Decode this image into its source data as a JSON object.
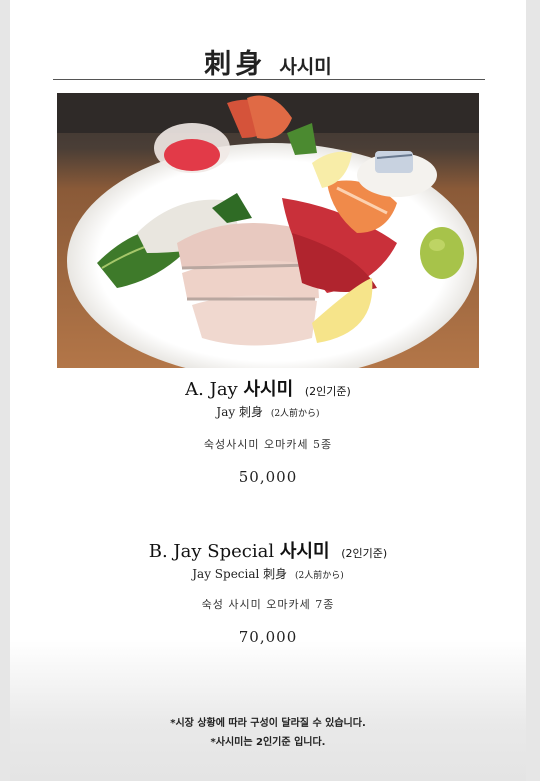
{
  "header": {
    "title_kanji": "刺身",
    "title_korean": "사시미"
  },
  "image": {
    "icon": "sashimi-platter-photo"
  },
  "menu": [
    {
      "name": "A. Jay",
      "name_korean": "사시미",
      "note": "(2인기준)",
      "sub_name": "Jay 刺身",
      "sub_note": "(2人前から)",
      "description": "숙성사시미 오마카세 5종",
      "price": "50,000"
    },
    {
      "name": "B. Jay Special",
      "name_korean": "사시미",
      "note": "(2인기준)",
      "sub_name": "Jay Special 刺身",
      "sub_note": "(2人前から)",
      "description": "숙성 사시미 오마카세 7종",
      "price": "70,000"
    }
  ],
  "footer_notes": [
    "*시장 상황에 따라 구성이 달라질 수 있습니다.",
    "*사시미는 2인기준 입니다."
  ],
  "colors": {
    "background": "#ffffff",
    "text": "#222222",
    "side_margin": "#e6e6e6"
  }
}
